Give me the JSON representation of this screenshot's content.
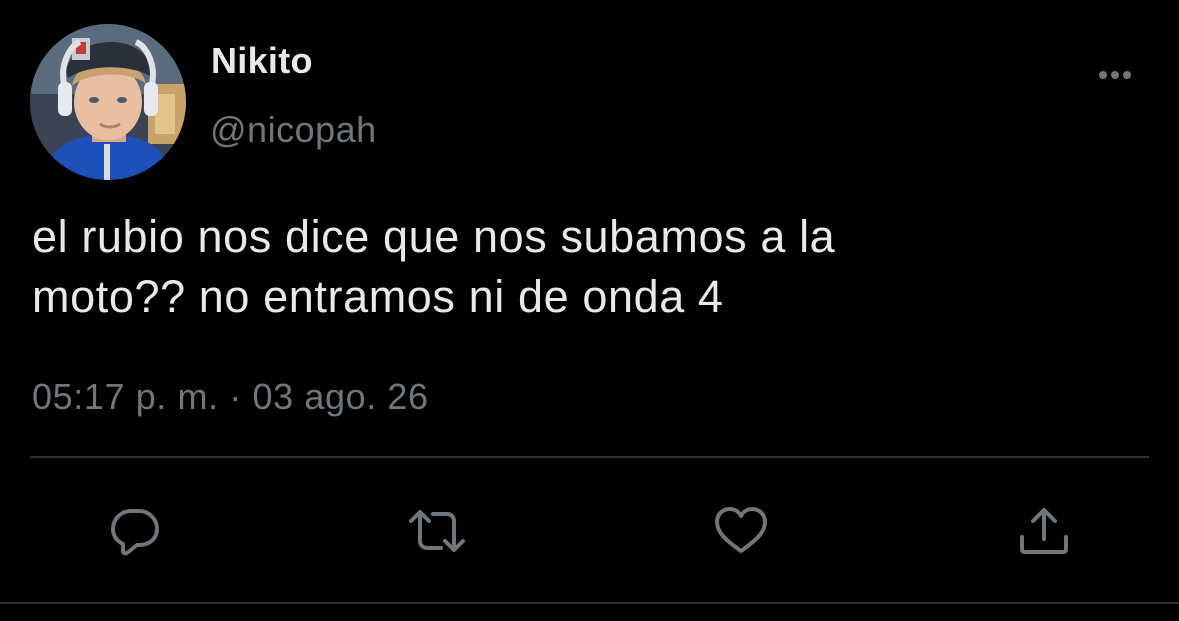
{
  "user": {
    "display_name": "Nikito",
    "handle": "@nicopah",
    "avatar_icon": "profile-photo"
  },
  "tweet": {
    "text_lines": [
      "el rubio nos dice que nos subamos a la",
      "moto?? no entramos ni de onda 4"
    ],
    "timestamp": "05:17 p. m. · 03 ago. 26"
  },
  "actions": {
    "more": "ellipsis-icon",
    "reply": "reply-icon",
    "retweet": "retweet-icon",
    "like": "heart-icon",
    "share": "share-icon"
  },
  "colors": {
    "background": "#000000",
    "primary_text": "#e7e9ea",
    "secondary_text": "#71767b",
    "divider": "#2f3336"
  }
}
